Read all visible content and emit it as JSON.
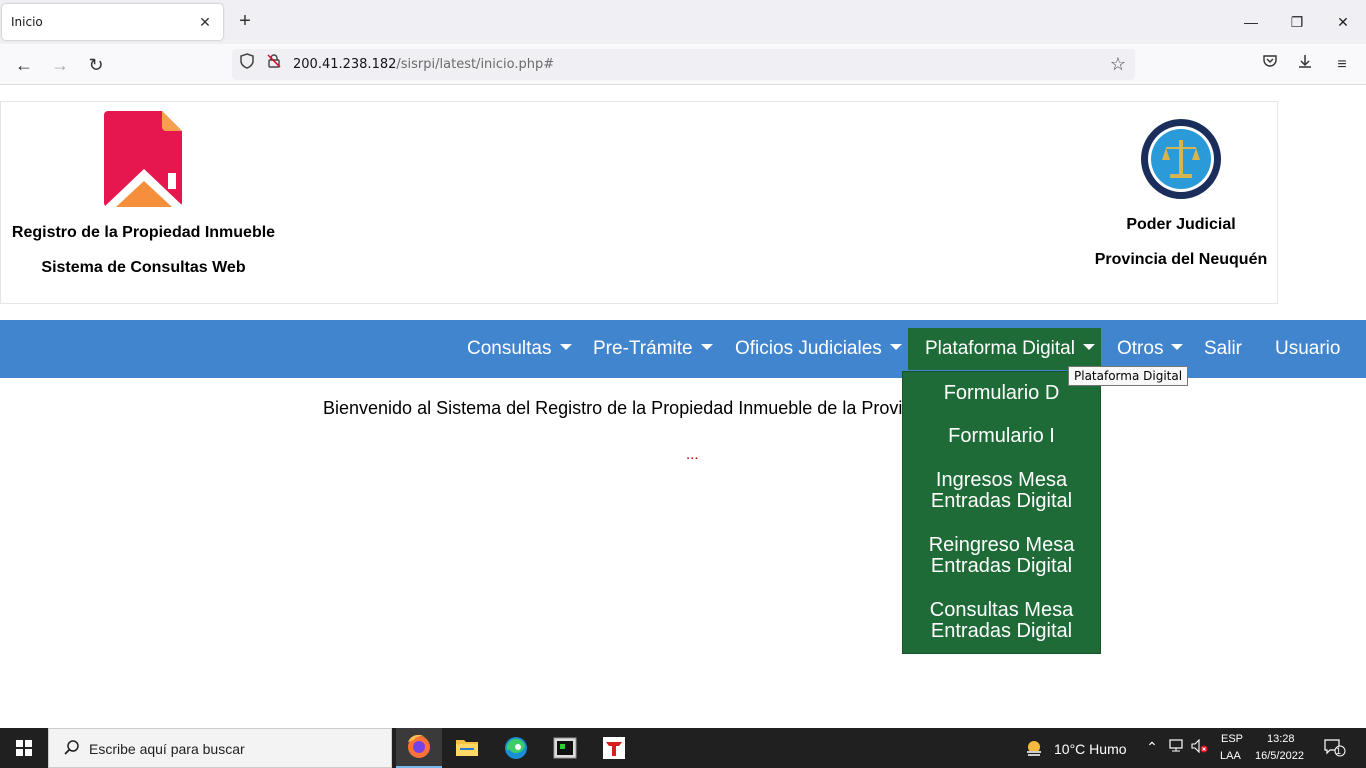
{
  "browser": {
    "tab_title": "Inicio",
    "tab_close": "✕",
    "new_tab": "+",
    "url_host": "200.41.238.182",
    "url_path": "/sisrpi/latest/inicio.php#",
    "window_minimize": "—",
    "window_restore": "❐",
    "window_close": "✕"
  },
  "header": {
    "left_title": "Registro de la Propiedad Inmueble",
    "left_subtitle": "Sistema de Consultas Web",
    "right_title": "Poder Judicial",
    "right_subtitle": "Provincia del Neuquén"
  },
  "menu": {
    "items": [
      {
        "label": "Consultas"
      },
      {
        "label": "Pre-Trámite"
      },
      {
        "label": "Oficios Judiciales"
      },
      {
        "label": "Plataforma Digital"
      },
      {
        "label": "Otros"
      },
      {
        "label": "Salir"
      },
      {
        "label": "Usuario"
      }
    ],
    "tooltip": "Plataforma Digital"
  },
  "dropdown": {
    "items": [
      {
        "line1": "Formulario D",
        "line2": ""
      },
      {
        "line1": "Formulario I",
        "line2": ""
      },
      {
        "line1": "Ingresos Mesa",
        "line2": "Entradas Digital"
      },
      {
        "line1": "Reingreso Mesa",
        "line2": "Entradas Digital"
      },
      {
        "line1": "Consultas Mesa",
        "line2": "Entradas Digital"
      }
    ]
  },
  "main": {
    "welcome": "Bienvenido al Sistema del Registro de la Propiedad Inmueble de la Provi",
    "dots": "..."
  },
  "taskbar": {
    "search_placeholder": "Escribe aquí para buscar",
    "weather": "10°C  Humo",
    "lang_top": "ESP",
    "lang_bottom": "LAA",
    "time": "13:28",
    "date": "16/5/2022",
    "notification_count": "1"
  },
  "colors": {
    "nav_blue": "#4285cf",
    "menu_green": "#1e6b38",
    "dots_red": "#c00000"
  }
}
